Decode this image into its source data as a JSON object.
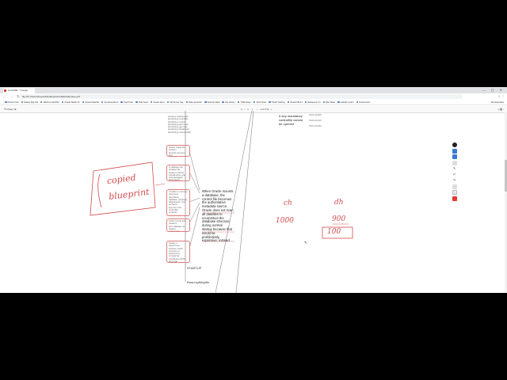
{
  "browser": {
    "tab_title": "controlfile - Google",
    "window_controls": "— ▢ ✕",
    "nav_icons": "← → ↻",
    "url": "file:///C:/Users/sravan/Desktop/controlfile%20notes.pdf",
    "addr_right_icons": "☆ ⋮",
    "bookmarks": [
      "Oracle Tutor",
      "Master Mgt Del",
      "Offshore DocPlan",
      "Oracle Weblo Fu",
      "Oracle Data Ba",
      "Syntavia Admin",
      "Toad Tutor",
      "Toad Suite",
      "Oracle Docs",
      "Sql Server Sup",
      "Data Ja Admin",
      "Netsuite Data",
      "Ora Library",
      "TOAD Exec",
      "Tech News",
      "TOAD Training",
      "Oracle DB Int",
      "Datapump Tut",
      "Dba Tasks",
      "Linkedin Learn",
      "Oracle Docs"
    ],
    "bookmarks_right": "All bookmarks"
  },
  "pdf_toolbar": {
    "left": "☰  Draw  |  ⊕",
    "page": "1 / 1",
    "zoom": "− 100% +",
    "right": "⤓  🖨  ⋮"
  },
  "doc": {
    "top_list": "instance sections ab\nidentifying controlfile\nidentifying control\nidentifying each redo\nidentifying sga redo\nidentifying checkpoint\nidentifying control (SID)",
    "box1": "Oracle reads the position\nthe last recovery and\ncontrolfile status",
    "box2": "It validates the updated file\nheaders (SCN),\ncheckpoints, and\nchangelogged information",
    "box3": "It builds in memory\nstructures describing\ndatafiles, redologs,\ntablespaces, the archived\nlogs from the controlfile\ncontents",
    "box4": "Fetch counts and headers\nand validates its header\nagainst the controlfile that\ncontrol",
    "box5": "Finally, it determines\nwhether crash recovery is\nrequired by comparing\ncheckpoint SCNs and redo\ninformation",
    "big_text": "When Oracle mounts\na database, the\ncontrol file becomes\nthe authoritative\nmetadata source.\nOracle does not scan\nall datafiles to\nreconstruct the\ndatabase structure\nduring normal\nstartup because that\nwould be\nprohibitively\nexpensive; instead",
    "startup": "STARTUP",
    "read_spfile": "Read spfile/pfile",
    "if_mandatory": "If any mandatory\ncontrolfile cannot\nbe opened",
    "ora_codes": [
      "ORA-00205",
      "ORA-00210",
      "ORA-00202"
    ],
    "handwriting": {
      "box_title": "copied\nblueprint",
      "ch": "ch",
      "dh": "dh",
      "v1": "1000",
      "v2": "900",
      "v3": "100"
    }
  },
  "annotation_tools": [
    "pen",
    "highlighter",
    "text",
    "shape",
    "eraser",
    "undo",
    "redo",
    "color-gray",
    "color-light",
    "color-red"
  ]
}
